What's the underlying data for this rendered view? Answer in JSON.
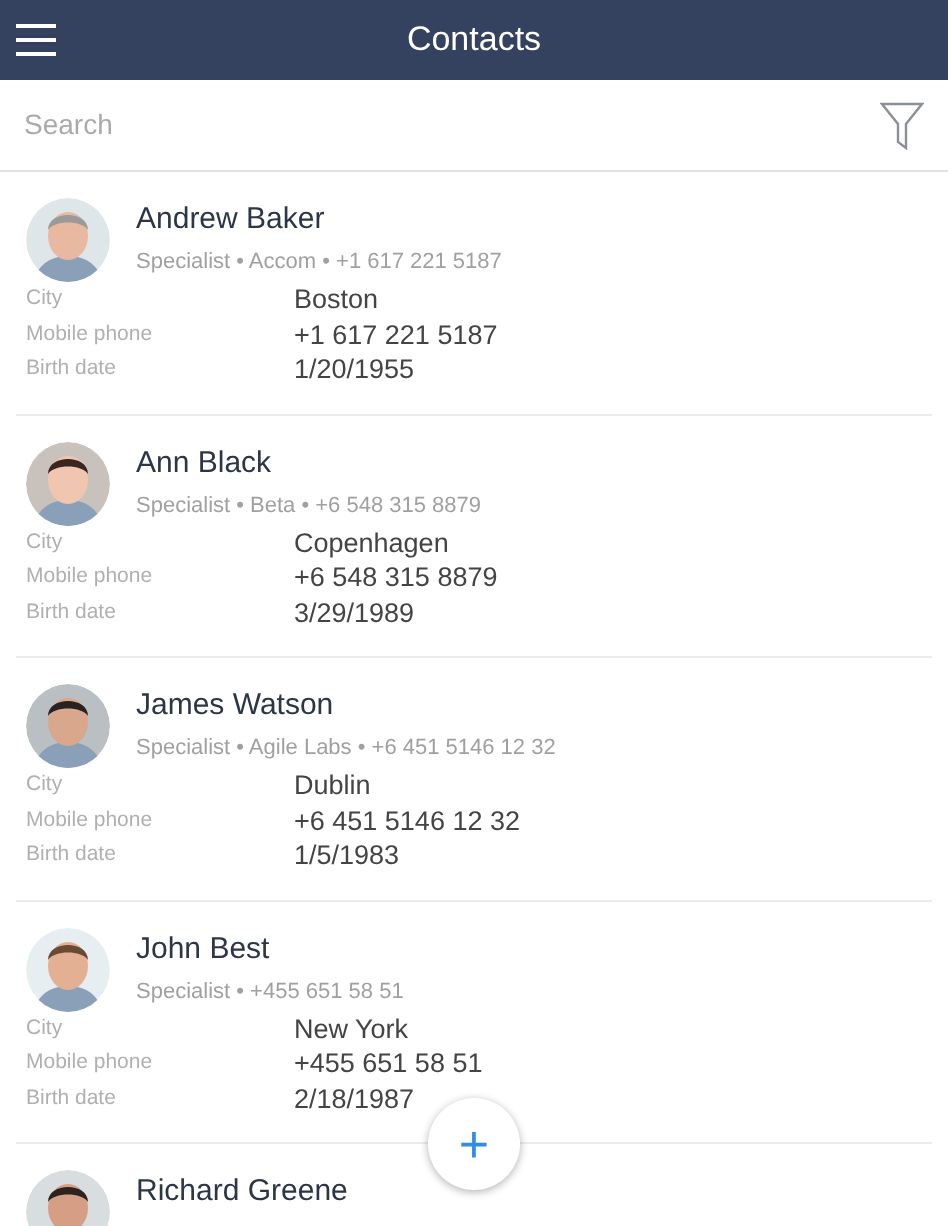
{
  "header": {
    "title": "Contacts"
  },
  "search": {
    "placeholder": "Search"
  },
  "contacts": [
    {
      "name": "Andrew Baker",
      "subtitle": "Specialist • Accom • +1 617 221 5187",
      "fields": [
        {
          "label": "City",
          "value": "Boston"
        },
        {
          "label": "Mobile phone",
          "value": "+1 617 221 5187"
        },
        {
          "label": "Birth date",
          "value": "1/20/1955"
        }
      ]
    },
    {
      "name": "Ann Black",
      "subtitle": "Specialist • Beta • +6 548 315 8879",
      "fields": [
        {
          "label": "City",
          "value": "Copenhagen"
        },
        {
          "label": "Mobile phone",
          "value": "+6 548 315 8879"
        },
        {
          "label": "Birth date",
          "value": "3/29/1989"
        }
      ]
    },
    {
      "name": "James Watson",
      "subtitle": "Specialist • Agile Labs • +6 451 5146 12 32",
      "fields": [
        {
          "label": "City",
          "value": "Dublin"
        },
        {
          "label": "Mobile phone",
          "value": "+6 451 5146 12 32"
        },
        {
          "label": "Birth date",
          "value": "1/5/1983"
        }
      ]
    },
    {
      "name": "John Best",
      "subtitle": "Specialist • +455 651 58 51",
      "fields": [
        {
          "label": "City",
          "value": "New York"
        },
        {
          "label": "Mobile phone",
          "value": "+455 651 58 51"
        },
        {
          "label": "Birth date",
          "value": "2/18/1987"
        }
      ]
    },
    {
      "name": "Richard Greene"
    }
  ],
  "add_button": {
    "label": "+"
  }
}
